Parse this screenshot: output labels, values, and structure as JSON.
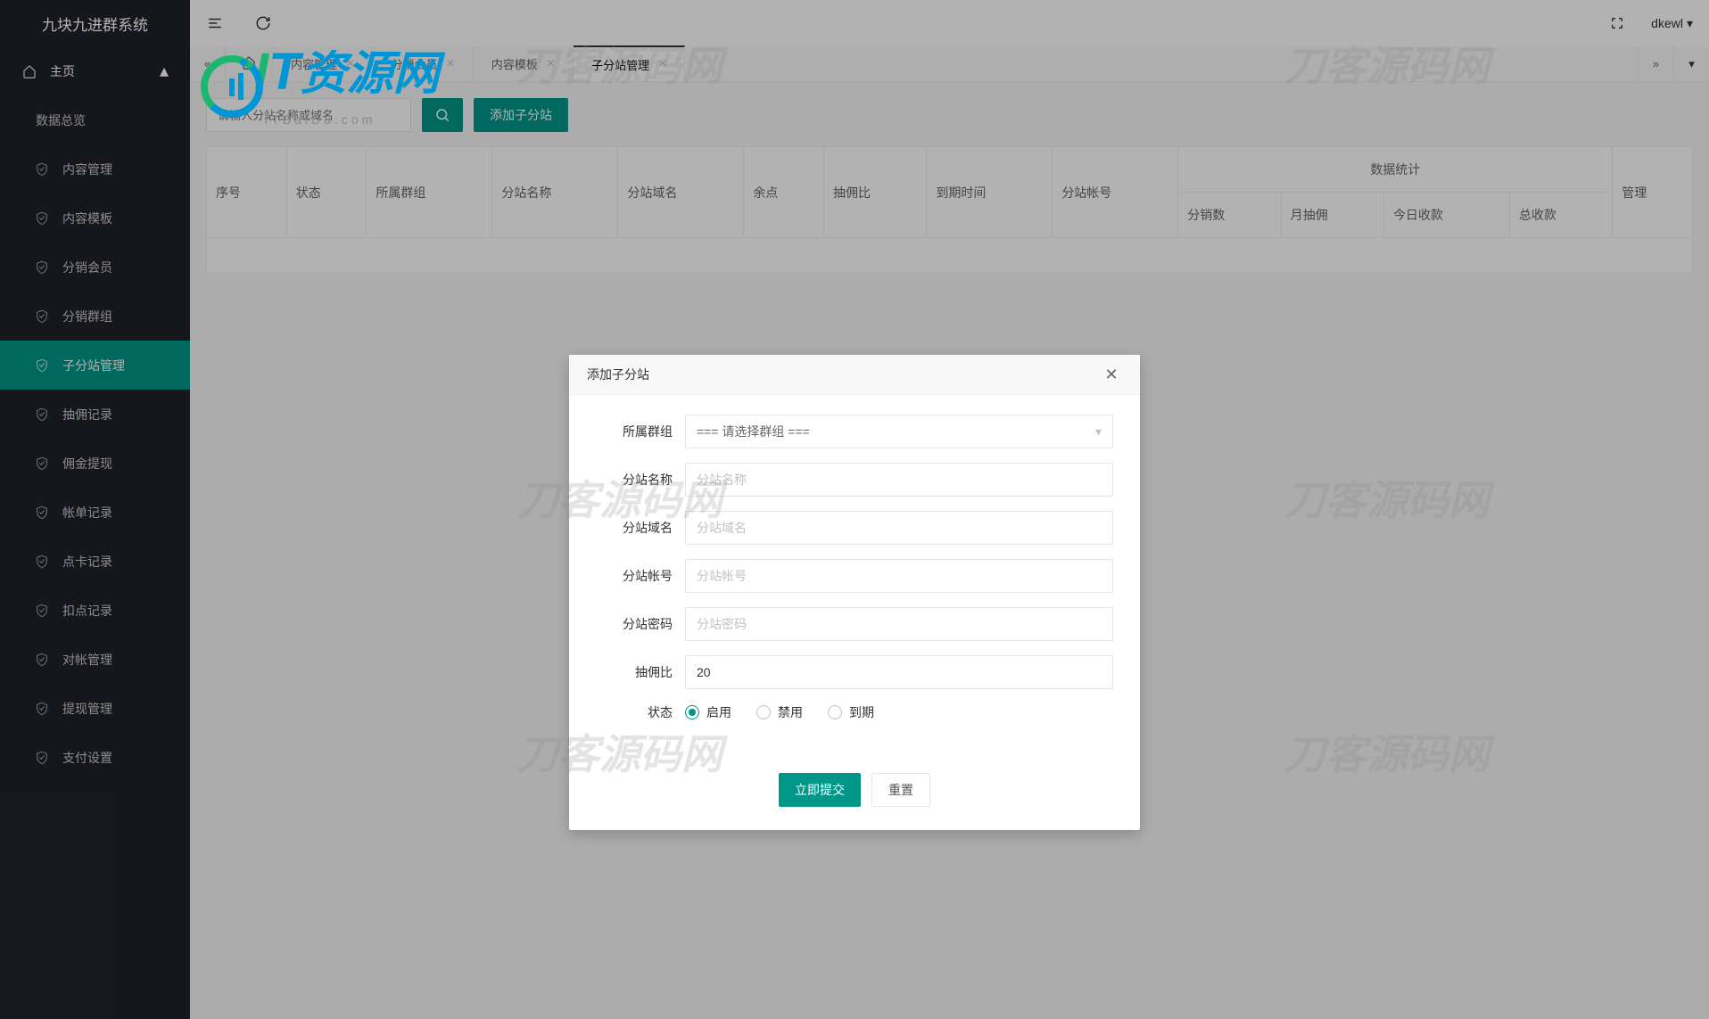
{
  "app_title": "九块九进群系统",
  "sidebar": {
    "group_label": "主页",
    "items": [
      {
        "label": "数据总览",
        "icon": ""
      },
      {
        "label": "内容管理",
        "icon": "shield"
      },
      {
        "label": "内容模板",
        "icon": "shield"
      },
      {
        "label": "分销会员",
        "icon": "shield"
      },
      {
        "label": "分销群组",
        "icon": "shield"
      },
      {
        "label": "子分站管理",
        "icon": "shield",
        "active": true
      },
      {
        "label": "抽佣记录",
        "icon": "shield"
      },
      {
        "label": "佣金提现",
        "icon": "shield"
      },
      {
        "label": "帐单记录",
        "icon": "shield"
      },
      {
        "label": "点卡记录",
        "icon": "shield"
      },
      {
        "label": "扣点记录",
        "icon": "shield"
      },
      {
        "label": "对帐管理",
        "icon": "shield"
      },
      {
        "label": "提现管理",
        "icon": "shield"
      },
      {
        "label": "支付设置",
        "icon": "shield"
      }
    ]
  },
  "topbar": {
    "user": "dkewl"
  },
  "tabs": {
    "items": [
      {
        "label": "内容管理"
      },
      {
        "label": "分销会员"
      },
      {
        "label": "内容模板"
      },
      {
        "label": "子分站管理",
        "active": true
      }
    ]
  },
  "toolbar": {
    "search_placeholder": "请输入分站名称或域名",
    "add_label": "添加子分站"
  },
  "table": {
    "headers": {
      "seq": "序号",
      "status": "状态",
      "group": "所属群组",
      "name": "分站名称",
      "domain": "分站域名",
      "balance": "余点",
      "commission": "抽佣比",
      "expire": "到期时间",
      "account": "分站帐号",
      "stats": "数据统计",
      "dist_count": "分销数",
      "month_comm": "月抽佣",
      "today_income": "今日收款",
      "total_income": "总收款",
      "manage": "管理"
    }
  },
  "modal": {
    "title": "添加子分站",
    "labels": {
      "group": "所属群组",
      "name": "分站名称",
      "domain": "分站域名",
      "account": "分站帐号",
      "password": "分站密码",
      "commission": "抽佣比",
      "status": "状态"
    },
    "group_placeholder": "=== 请选择群组 ===",
    "name_placeholder": "分站名称",
    "domain_placeholder": "分站域名",
    "account_placeholder": "分站帐号",
    "password_placeholder": "分站密码",
    "commission_value": "20",
    "status_options": {
      "enabled": "启用",
      "disabled": "禁用",
      "expired": "到期"
    },
    "submit": "立即提交",
    "reset": "重置"
  },
  "watermarks": {
    "text": "刀客源码网",
    "itbaidu": "ITBaiDu.com"
  }
}
